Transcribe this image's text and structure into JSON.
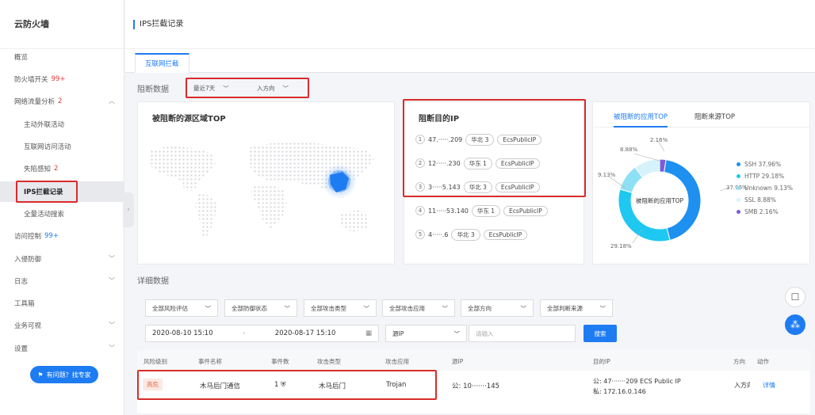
{
  "sidebar": {
    "title": "云防火墙",
    "items": [
      {
        "label": "概览",
        "badge": ""
      },
      {
        "label": "防火墙开关",
        "badge": "99+"
      },
      {
        "label": "网络流量分析",
        "badge": "2"
      },
      {
        "label": "主动外联活动",
        "badge": ""
      },
      {
        "label": "互联网访问活动",
        "badge": ""
      },
      {
        "label": "失陷感知",
        "badge": "2"
      },
      {
        "label": "IPS拦截记录",
        "badge": ""
      },
      {
        "label": "全量活动搜索",
        "badge": ""
      },
      {
        "label": "访问控制",
        "badge": "99+"
      },
      {
        "label": "入侵防御",
        "badge": ""
      },
      {
        "label": "日志",
        "badge": ""
      },
      {
        "label": "工具箱",
        "badge": ""
      },
      {
        "label": "业务可视",
        "badge": ""
      },
      {
        "label": "设置",
        "badge": ""
      }
    ],
    "help_button": "有问题？找专家"
  },
  "header": {
    "title": "IPS拦截记录"
  },
  "tabs": [
    {
      "label": "互联网拦截"
    }
  ],
  "block_section": {
    "title": "阻断数据",
    "time_select": "最近7天",
    "direction_select": "入方向"
  },
  "region_card": {
    "title": "被阻断的源区域TOP"
  },
  "ip_card": {
    "title": "阻断目的IP",
    "rows": [
      {
        "index": "1",
        "ip": "47.·····.209",
        "region": "华北 3",
        "type": "EcsPublicIP"
      },
      {
        "index": "2",
        "ip": "12·····.230",
        "region": "华东 1",
        "type": "EcsPublicIP"
      },
      {
        "index": "3",
        "ip": "3·····5.143",
        "region": "华北 3",
        "type": "EcsPublicIP"
      },
      {
        "index": "4",
        "ip": "11·····53.140",
        "region": "华东 1",
        "type": "EcsPublicIP"
      },
      {
        "index": "5",
        "ip": "4·····.6",
        "region": "华北 3",
        "type": "EcsPublicIP"
      }
    ]
  },
  "app_card": {
    "tab_apps": "被阻断的应用TOP",
    "tab_sources": "阻断来源TOP",
    "center_label": "被阻断的应用TOP",
    "labels": [
      "2.16%",
      "8.88%",
      "9.13%",
      "37.96%",
      "29.18%"
    ],
    "legend": [
      {
        "name": "SSH 37.96%",
        "color": "#1e90f0"
      },
      {
        "name": "HTTP 29.18%",
        "color": "#1ec8f0"
      },
      {
        "name": "Unknown 9.13%",
        "color": "#8ee0f5"
      },
      {
        "name": "SSL 8.88%",
        "color": "#d6f3fb"
      },
      {
        "name": "SMB 2.16%",
        "color": "#7c5cd6"
      }
    ]
  },
  "chart_data": {
    "type": "pie",
    "categories": [
      "SSH",
      "HTTP",
      "Unknown",
      "SSL",
      "SMB"
    ],
    "values": [
      37.96,
      29.18,
      9.13,
      8.88,
      2.16
    ]
  },
  "detail_section": {
    "title": "详细数据",
    "filters": [
      "全部风险评估",
      "全部防御状态",
      "全部攻击类型",
      "全部攻击应用",
      "全部方向",
      "全部判断来源"
    ],
    "date_start": "2020-08-10 15:10",
    "date_sep": "-",
    "date_end": "2020-08-17 15:10",
    "ip_type": "源IP",
    "search_placeholder": "请输入",
    "search_button": "搜索",
    "columns": [
      "风险级别",
      "事件名称",
      "事件数",
      "攻击类型",
      "攻击应用",
      "源IP",
      "目的IP",
      "方向",
      "动作"
    ],
    "row": {
      "severity": "高危",
      "event_name": "木马后门通信",
      "count": "1",
      "attack_type": "木马后门",
      "attack_app": "Trojan",
      "src_ip": "公:  10·······145",
      "dst_public": "公:  47·······209  ECS Public IP",
      "dst_private": "私:  172.16.0.146",
      "direction": "入方向",
      "action": "详情"
    }
  }
}
